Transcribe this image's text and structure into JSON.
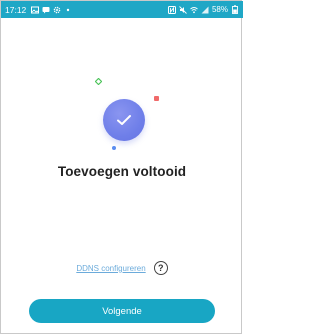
{
  "status_bar": {
    "time": "17:12",
    "battery_text": "58%",
    "left_icons": [
      "gallery-icon",
      "message-icon",
      "settings-icon",
      "dot-icon"
    ],
    "right_icons": [
      "nfc-icon",
      "mute-icon",
      "wifi-icon",
      "signal-icon",
      "battery-icon"
    ],
    "color": "#1fa7c6"
  },
  "main": {
    "title": "Toevoegen voltooid",
    "success_icon": "check-icon",
    "accent_color": "#6f7fe9"
  },
  "ddns": {
    "link_label": "DDNS configureren",
    "help_symbol": "?"
  },
  "footer": {
    "next_label": "Volgende",
    "button_color": "#18a6c4"
  }
}
